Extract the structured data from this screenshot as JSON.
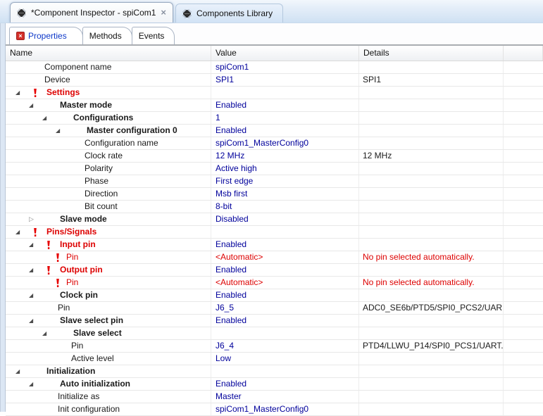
{
  "window": {
    "editor_tabs": [
      {
        "label": "*Component Inspector - spiCom1",
        "selected": true,
        "closable": true,
        "icon": "component-chip-icon",
        "close_glyph": "×"
      },
      {
        "label": "Components Library",
        "selected": false,
        "icon": "component-chip-icon"
      }
    ],
    "view_tabs": [
      {
        "label": "Properties",
        "selected": true,
        "has_error": true,
        "error_glyph": "×"
      },
      {
        "label": "Methods",
        "selected": false
      },
      {
        "label": "Events",
        "selected": false
      }
    ]
  },
  "table": {
    "columns": [
      "Name",
      "Value",
      "Details"
    ],
    "rows": [
      {
        "level": 1,
        "arrow": "none",
        "error": false,
        "group": false,
        "name": "Component name",
        "name_red": false,
        "value": "spiCom1",
        "value_red": false,
        "details": "",
        "details_red": false
      },
      {
        "level": 1,
        "arrow": "none",
        "error": false,
        "group": false,
        "name": "Device",
        "name_red": false,
        "value": "SPI1",
        "value_red": false,
        "details": "SPI1",
        "details_red": false
      },
      {
        "level": 0,
        "arrow": "expanded",
        "error": true,
        "group": true,
        "name": "Settings",
        "name_red": true,
        "value": "",
        "value_red": false,
        "details": "",
        "details_red": false
      },
      {
        "level": 1,
        "arrow": "expanded",
        "error": false,
        "group": true,
        "name": "Master mode",
        "name_red": false,
        "value": "Enabled",
        "value_red": false,
        "details": "",
        "details_red": false
      },
      {
        "level": 2,
        "arrow": "expanded",
        "error": false,
        "group": true,
        "name": "Configurations",
        "name_red": false,
        "value": "1",
        "value_red": false,
        "details": "",
        "details_red": false
      },
      {
        "level": 3,
        "arrow": "expanded",
        "error": false,
        "group": true,
        "name": "Master configuration 0",
        "name_red": false,
        "value": "Enabled",
        "value_red": false,
        "details": "",
        "details_red": false
      },
      {
        "level": 4,
        "arrow": "none",
        "error": false,
        "group": false,
        "name": "Configuration name",
        "name_red": false,
        "value": "spiCom1_MasterConfig0",
        "value_red": false,
        "details": "",
        "details_red": false
      },
      {
        "level": 4,
        "arrow": "none",
        "error": false,
        "group": false,
        "name": "Clock rate",
        "name_red": false,
        "value": "12 MHz",
        "value_red": false,
        "details": "12 MHz",
        "details_red": false
      },
      {
        "level": 4,
        "arrow": "none",
        "error": false,
        "group": false,
        "name": "Polarity",
        "name_red": false,
        "value": "Active high",
        "value_red": false,
        "details": "",
        "details_red": false
      },
      {
        "level": 4,
        "arrow": "none",
        "error": false,
        "group": false,
        "name": "Phase",
        "name_red": false,
        "value": "First edge",
        "value_red": false,
        "details": "",
        "details_red": false
      },
      {
        "level": 4,
        "arrow": "none",
        "error": false,
        "group": false,
        "name": "Direction",
        "name_red": false,
        "value": "Msb first",
        "value_red": false,
        "details": "",
        "details_red": false
      },
      {
        "level": 4,
        "arrow": "none",
        "error": false,
        "group": false,
        "name": "Bit count",
        "name_red": false,
        "value": "8-bit",
        "value_red": false,
        "details": "",
        "details_red": false
      },
      {
        "level": 1,
        "arrow": "collapsed",
        "error": false,
        "group": true,
        "name": "Slave mode",
        "name_red": false,
        "value": "Disabled",
        "value_red": false,
        "details": "",
        "details_red": false
      },
      {
        "level": 0,
        "arrow": "expanded",
        "error": true,
        "group": true,
        "name": "Pins/Signals",
        "name_red": true,
        "value": "",
        "value_red": false,
        "details": "",
        "details_red": false
      },
      {
        "level": 1,
        "arrow": "expanded",
        "error": true,
        "group": true,
        "name": "Input pin",
        "name_red": true,
        "value": "Enabled",
        "value_red": false,
        "details": "",
        "details_red": false
      },
      {
        "level": 2,
        "arrow": "none",
        "error": true,
        "group": false,
        "name": "Pin",
        "name_red": true,
        "value": "<Automatic>",
        "value_red": true,
        "details": "No pin selected automatically.",
        "details_red": true
      },
      {
        "level": 1,
        "arrow": "expanded",
        "error": true,
        "group": true,
        "name": "Output pin",
        "name_red": true,
        "value": "Enabled",
        "value_red": false,
        "details": "",
        "details_red": false
      },
      {
        "level": 2,
        "arrow": "none",
        "error": true,
        "group": false,
        "name": "Pin",
        "name_red": true,
        "value": "<Automatic>",
        "value_red": true,
        "details": "No pin selected automatically.",
        "details_red": true
      },
      {
        "level": 1,
        "arrow": "expanded",
        "error": false,
        "group": true,
        "name": "Clock pin",
        "name_red": false,
        "value": "Enabled",
        "value_red": false,
        "details": "",
        "details_red": false
      },
      {
        "level": 2,
        "arrow": "none",
        "error": false,
        "group": false,
        "name": "Pin",
        "name_red": false,
        "value": "J6_5",
        "value_red": false,
        "details": "ADC0_SE6b/PTD5/SPI0_PCS2/UAR...",
        "details_red": false
      },
      {
        "level": 1,
        "arrow": "expanded",
        "error": false,
        "group": true,
        "name": "Slave select pin",
        "name_red": false,
        "value": "Enabled",
        "value_red": false,
        "details": "",
        "details_red": false
      },
      {
        "level": 2,
        "arrow": "expanded",
        "error": false,
        "group": true,
        "name": "Slave select",
        "name_red": false,
        "value": "",
        "value_red": false,
        "details": "",
        "details_red": false
      },
      {
        "level": 3,
        "arrow": "none",
        "error": false,
        "group": false,
        "name": "Pin",
        "name_red": false,
        "value": "J6_4",
        "value_red": false,
        "details": "PTD4/LLWU_P14/SPI0_PCS1/UART...",
        "details_red": false
      },
      {
        "level": 3,
        "arrow": "none",
        "error": false,
        "group": false,
        "name": "Active level",
        "name_red": false,
        "value": "Low",
        "value_red": false,
        "details": "",
        "details_red": false
      },
      {
        "level": 0,
        "arrow": "expanded",
        "error": false,
        "group": true,
        "name": "Initialization",
        "name_red": false,
        "value": "",
        "value_red": false,
        "details": "",
        "details_red": false
      },
      {
        "level": 1,
        "arrow": "expanded",
        "error": false,
        "group": true,
        "name": "Auto initialization",
        "name_red": false,
        "value": "Enabled",
        "value_red": false,
        "details": "",
        "details_red": false
      },
      {
        "level": 2,
        "arrow": "none",
        "error": false,
        "group": false,
        "name": "Initialize as",
        "name_red": false,
        "value": "Master",
        "value_red": false,
        "details": "",
        "details_red": false
      },
      {
        "level": 2,
        "arrow": "none",
        "error": false,
        "group": false,
        "name": "Init configuration",
        "name_red": false,
        "value": "spiCom1_MasterConfig0",
        "value_red": false,
        "details": "",
        "details_red": false
      }
    ]
  },
  "icons": {
    "expanded_glyph": "◢",
    "collapsed_glyph": "▷",
    "error_icon": "red-exclamation-icon"
  },
  "colors": {
    "value_text": "#00009b",
    "error_text": "#dd0000",
    "tabbar_blue": "#cfe1f3",
    "grid_line": "#e8e8e8"
  }
}
